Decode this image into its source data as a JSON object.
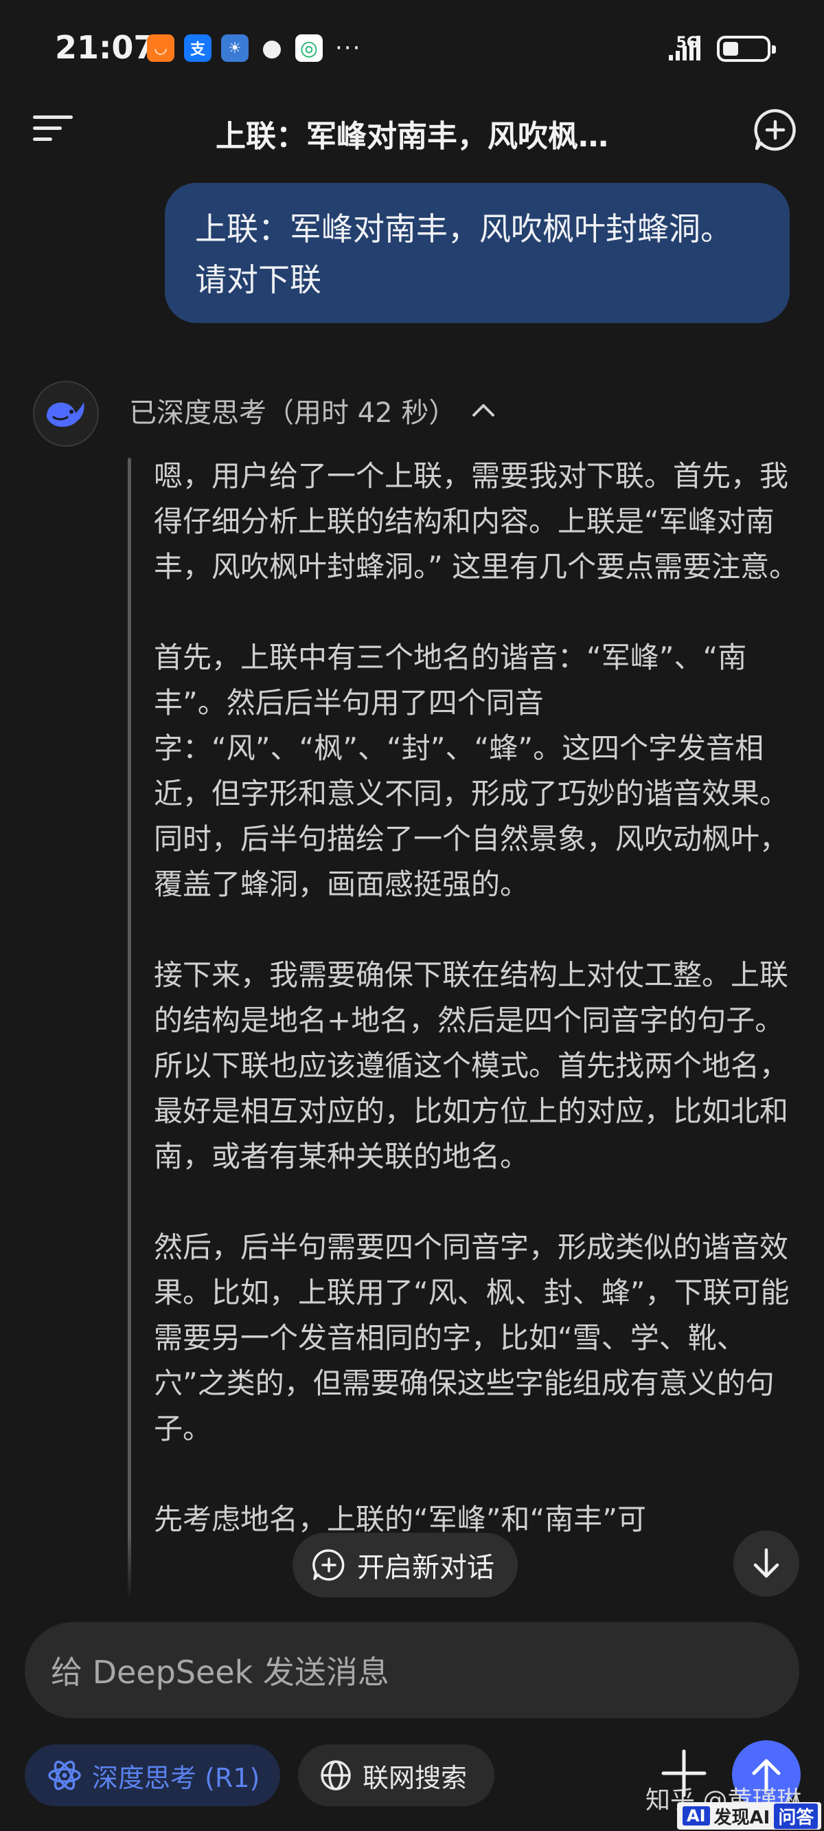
{
  "status_bar": {
    "time": "21:07",
    "network": "5G",
    "app_icons": [
      {
        "name": "taobao-icon",
        "glyph": "◡",
        "color": "#ff7a1a"
      },
      {
        "name": "alipay-icon",
        "glyph": "支",
        "color": "#1677ff"
      },
      {
        "name": "weather-icon",
        "glyph": "☀",
        "color": "#3a7bd5"
      },
      {
        "name": "chat-icon",
        "glyph": "●",
        "color": "#f0f0f0"
      },
      {
        "name": "app-icon",
        "glyph": "◎",
        "color": "#16b36b"
      }
    ],
    "more": "···"
  },
  "header": {
    "title": "上联：军峰对南丰，风吹枫…"
  },
  "user_message": "上联：军峰对南丰，风吹枫叶封蜂洞。请对下联",
  "assistant": {
    "thinking_label": "已深度思考（用时 42 秒）",
    "paragraphs": [
      "嗯，用户给了一个上联，需要我对下联。首先，我得仔细分析上联的结构和内容。上联是“军峰对南丰，风吹枫叶封蜂洞。” 这里有几个要点需要注意。",
      "首先，上联中有三个地名的谐音：“军峰”、“南丰”。然后后半句用了四个同音字：“风”、“枫”、“封”、“蜂”。这四个字发音相近，但字形和意义不同，形成了巧妙的谐音效果。同时，后半句描绘了一个自然景象，风吹动枫叶，覆盖了蜂洞，画面感挺强的。",
      "接下来，我需要确保下联在结构上对仗工整。上联的结构是地名+地名，然后是四个同音字的句子。所以下联也应该遵循这个模式。首先找两个地名，最好是相互对应的，比如方位上的对应，比如北和南，或者有某种关联的地名。",
      "然后，后半句需要四个同音字，形成类似的谐音效果。比如，上联用了“风、枫、封、蜂”，下联可能需要另一个发音相同的字，比如“雪、学、靴、穴”之类的，但需要确保这些字能组成有意义的句子。",
      "先考虑地名，上联的“军峰”和“南丰”可"
    ]
  },
  "floating": {
    "new_chat_label": "开启新对话"
  },
  "input": {
    "placeholder": "给 DeepSeek 发送消息"
  },
  "bottom_bar": {
    "deep_think_label": "深度思考 (R1)",
    "web_search_label": "联网搜索"
  },
  "watermark": {
    "text": "知乎 @黄瑾琳",
    "badge_a": "AI",
    "badge_b": "发现AI",
    "badge_c": "问答"
  },
  "colors": {
    "background": "#181818",
    "user_bubble": "#24406e",
    "accent": "#4d6bfe",
    "deep_think_text": "#5b82f0"
  }
}
